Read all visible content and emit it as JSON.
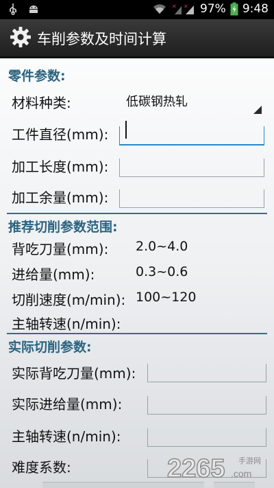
{
  "status_bar": {
    "battery": "97%",
    "time": "9:48",
    "icons": [
      "usb-icon",
      "android-icon",
      "wifi-icon",
      "signal-icon",
      "battery-icon"
    ]
  },
  "header": {
    "title": "车削参数及时间计算",
    "icon": "gear-icon"
  },
  "part_params": {
    "section": "零件参数:",
    "material_label": "材料种类:",
    "material_value": "低碳钢热轧",
    "diameter_label": "工件直径(mm):",
    "diameter_value": "",
    "length_label": "加工长度(mm):",
    "length_value": "",
    "allowance_label": "加工余量(mm):",
    "allowance_value": ""
  },
  "recommended": {
    "section": "推荐切削参数范围:",
    "rows": [
      {
        "label": "背吃刀量(mm):",
        "value": "2.0~4.0"
      },
      {
        "label": "进给量(mm):",
        "value": "0.3~0.6"
      },
      {
        "label": "切削速度(m/min):",
        "value": "100~120"
      },
      {
        "label": "主轴转速(n/min):",
        "value": ""
      }
    ]
  },
  "actual": {
    "section": "实际切削参数:",
    "rows": [
      {
        "label": "实际背吃刀量(mm):",
        "value": ""
      },
      {
        "label": "实际进给量(mm):",
        "value": ""
      },
      {
        "label": "主轴转速(n/min):",
        "value": ""
      },
      {
        "label": "难度系数:",
        "value": ""
      }
    ]
  },
  "watermark": {
    "text": "2265",
    "sub": ".com",
    "cn": "手游网"
  },
  "colors": {
    "accent": "#2a87c4",
    "section": "#2a6380",
    "actionbar": "#2b2b2b"
  }
}
